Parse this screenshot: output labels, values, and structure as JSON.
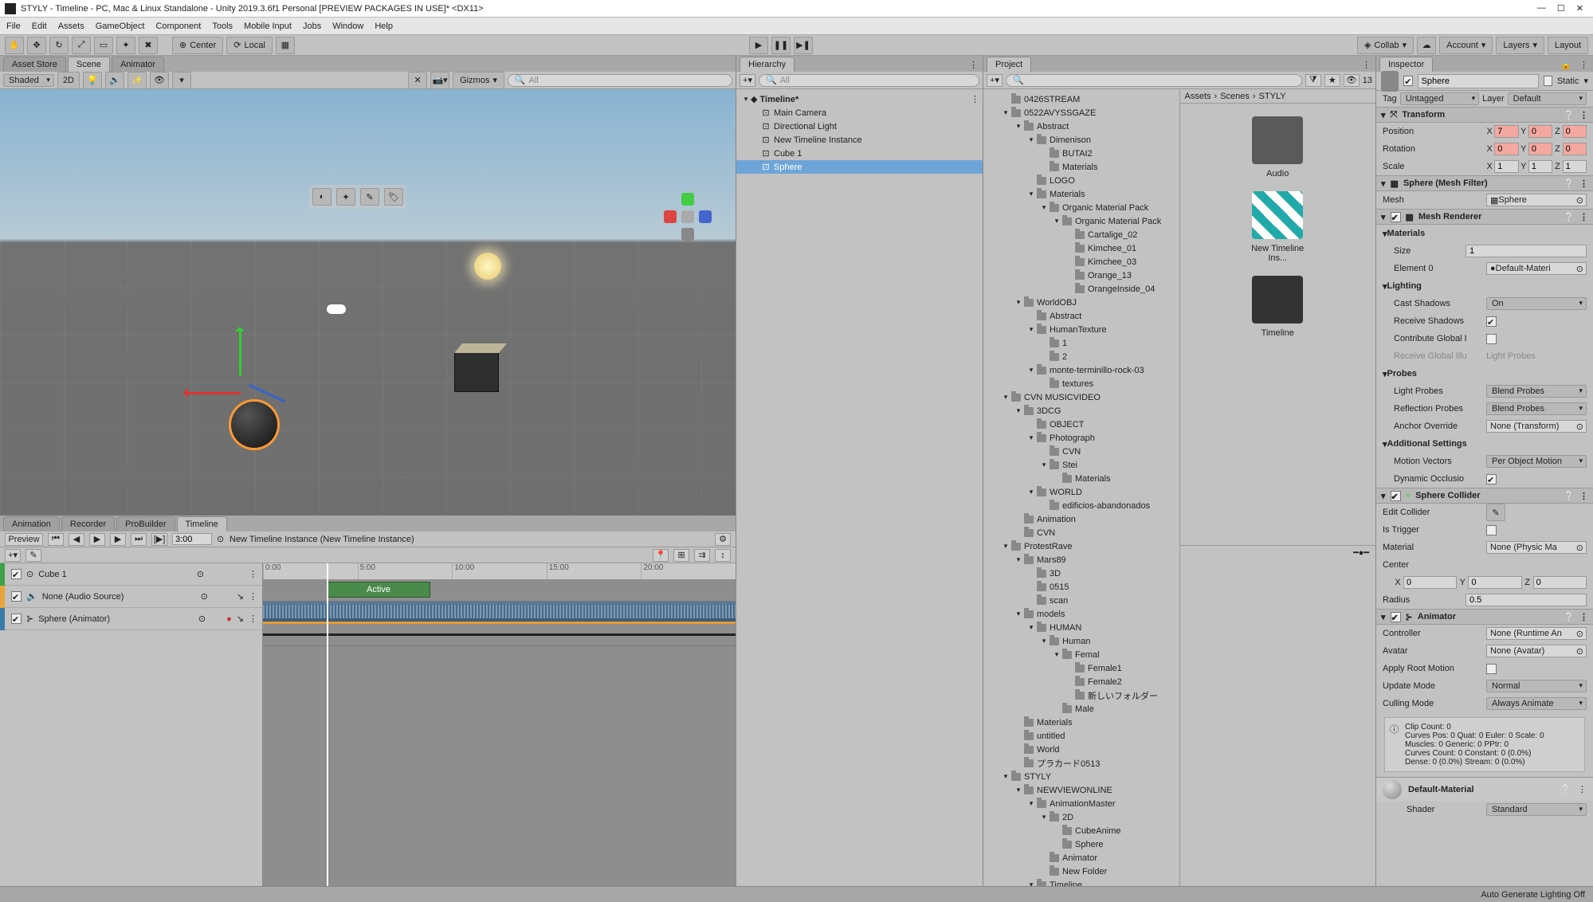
{
  "window": {
    "title": "STYLY - Timeline - PC, Mac & Linux Standalone - Unity 2019.3.6f1 Personal [PREVIEW PACKAGES IN USE]* <DX11>"
  },
  "menu": [
    "File",
    "Edit",
    "Assets",
    "GameObject",
    "Component",
    "Tools",
    "Mobile Input",
    "Jobs",
    "Window",
    "Help"
  ],
  "toolbar": {
    "center": "Center",
    "local": "Local",
    "collab": "Collab",
    "account": "Account",
    "layers": "Layers",
    "layout": "Layout"
  },
  "sceneTabs": {
    "asset": "Asset Store",
    "scene": "Scene",
    "animator": "Animator"
  },
  "sceneBar": {
    "shaded": "Shaded",
    "mode2d": "2D",
    "gizmos": "Gizmos",
    "all": "All"
  },
  "hierarchy": {
    "tab": "Hierarchy",
    "search": "All",
    "rootScene": "Timeline*",
    "items": [
      "Main Camera",
      "Directional Light",
      "New Timeline Instance",
      "Cube 1",
      "Sphere"
    ]
  },
  "project": {
    "tab": "Project",
    "breadcrumb": [
      "Assets",
      "Scenes",
      "STYLY"
    ],
    "favCount": "13",
    "thumbs": [
      {
        "label": "Audio"
      },
      {
        "label": "New Timeline Ins..."
      },
      {
        "label": "Timeline"
      }
    ],
    "tree": [
      {
        "d": 1,
        "label": "0426STREAM"
      },
      {
        "d": 1,
        "label": "0522AVYSSGAZE",
        "open": true
      },
      {
        "d": 2,
        "label": "Abstract",
        "open": true
      },
      {
        "d": 3,
        "label": "Dimenison",
        "open": true
      },
      {
        "d": 4,
        "label": "BUTAI2"
      },
      {
        "d": 4,
        "label": "Materials"
      },
      {
        "d": 3,
        "label": "LOGO"
      },
      {
        "d": 3,
        "label": "Materials",
        "open": true
      },
      {
        "d": 4,
        "label": "Organic Material Pack",
        "open": true
      },
      {
        "d": 5,
        "label": "Organic Material Pack",
        "open": true
      },
      {
        "d": 6,
        "label": "Cartalige_02"
      },
      {
        "d": 6,
        "label": "Kimchee_01"
      },
      {
        "d": 6,
        "label": "Kimchee_03"
      },
      {
        "d": 6,
        "label": "Orange_13"
      },
      {
        "d": 6,
        "label": "OrangeInside_04"
      },
      {
        "d": 2,
        "label": "WorldOBJ",
        "open": true
      },
      {
        "d": 3,
        "label": "Abstract"
      },
      {
        "d": 3,
        "label": "HumanTexture",
        "open": true
      },
      {
        "d": 4,
        "label": "1"
      },
      {
        "d": 4,
        "label": "2"
      },
      {
        "d": 3,
        "label": "monte-terminillo-rock-03",
        "open": true
      },
      {
        "d": 4,
        "label": "textures"
      },
      {
        "d": 1,
        "label": "CVN MUSICVIDEO",
        "open": true
      },
      {
        "d": 2,
        "label": "3DCG",
        "open": true
      },
      {
        "d": 3,
        "label": "OBJECT"
      },
      {
        "d": 3,
        "label": "Photograph",
        "open": true
      },
      {
        "d": 4,
        "label": "CVN"
      },
      {
        "d": 4,
        "label": "Stei",
        "open": true
      },
      {
        "d": 5,
        "label": "Materials"
      },
      {
        "d": 3,
        "label": "WORLD",
        "open": true
      },
      {
        "d": 4,
        "label": "edificios-abandonados"
      },
      {
        "d": 2,
        "label": "Animation"
      },
      {
        "d": 2,
        "label": "CVN"
      },
      {
        "d": 1,
        "label": "ProtestRave",
        "open": true
      },
      {
        "d": 2,
        "label": "Mars89",
        "open": true
      },
      {
        "d": 3,
        "label": "3D"
      },
      {
        "d": 3,
        "label": "0515"
      },
      {
        "d": 3,
        "label": "scan"
      },
      {
        "d": 2,
        "label": "models",
        "open": true
      },
      {
        "d": 3,
        "label": "HUMAN",
        "open": true
      },
      {
        "d": 4,
        "label": "Human",
        "open": true
      },
      {
        "d": 5,
        "label": "Femal",
        "open": true
      },
      {
        "d": 6,
        "label": "Female1"
      },
      {
        "d": 6,
        "label": "Female2"
      },
      {
        "d": 6,
        "label": "新しいフォルダー"
      },
      {
        "d": 5,
        "label": "Male"
      },
      {
        "d": 2,
        "label": "Materials"
      },
      {
        "d": 2,
        "label": "untitled"
      },
      {
        "d": 2,
        "label": "World"
      },
      {
        "d": 2,
        "label": "プラカード0513"
      },
      {
        "d": 1,
        "label": "STYLY",
        "open": true
      },
      {
        "d": 2,
        "label": "NEWVIEWONLINE",
        "open": true
      },
      {
        "d": 3,
        "label": "AnimationMaster",
        "open": true
      },
      {
        "d": 4,
        "label": "2D",
        "open": true
      },
      {
        "d": 5,
        "label": "CubeAnime"
      },
      {
        "d": 5,
        "label": "Sphere"
      },
      {
        "d": 4,
        "label": "Animator"
      },
      {
        "d": 4,
        "label": "New Folder"
      },
      {
        "d": 3,
        "label": "Timeline",
        "open": true
      }
    ]
  },
  "timeline": {
    "tabs": [
      "Animation",
      "Recorder",
      "ProBuilder",
      "Timeline"
    ],
    "preview": "Preview",
    "frame": "3:00",
    "asset": "New Timeline Instance (New Timeline Instance)",
    "ticks": [
      "0:00",
      "5:00",
      "10:00",
      "15:00",
      "20:00"
    ],
    "tracks": [
      {
        "color": "#3aa34a",
        "label": "Cube 1",
        "clip": "Active"
      },
      {
        "color": "#e6a43a",
        "label": "None (Audio Source)"
      },
      {
        "color": "#3a7aa8",
        "label": "Sphere (Animator)"
      }
    ]
  },
  "inspector": {
    "tab": "Inspector",
    "name": "Sphere",
    "static": "Static",
    "tag": "Tag",
    "tagVal": "Untagged",
    "layer": "Layer",
    "layerVal": "Default",
    "transform": {
      "title": "Transform",
      "position": "Position",
      "rotation": "Rotation",
      "scale": "Scale",
      "pos": {
        "x": "7",
        "y": "0",
        "z": "0"
      },
      "rot": {
        "x": "0",
        "y": "0",
        "z": "0"
      },
      "scl": {
        "x": "1",
        "y": "1",
        "z": "1"
      }
    },
    "meshFilter": {
      "title": "Sphere (Mesh Filter)",
      "mesh": "Mesh",
      "meshVal": "Sphere"
    },
    "meshRenderer": {
      "title": "Mesh Renderer",
      "materials": "Materials",
      "size": "Size",
      "sizeVal": "1",
      "el0": "Element 0",
      "el0Val": "Default-Materi",
      "lighting": "Lighting",
      "castShadows": "Cast Shadows",
      "castShadowsVal": "On",
      "receive": "Receive Shadows",
      "contrib": "Contribute Global I",
      "recvGI": "Receive Global Illu",
      "recvGIVal": "Light Probes",
      "probes": "Probes",
      "lightProbes": "Light Probes",
      "lightProbesVal": "Blend Probes",
      "reflProbes": "Reflection Probes",
      "reflProbesVal": "Blend Probes",
      "anchor": "Anchor Override",
      "anchorVal": "None (Transform)",
      "additional": "Additional Settings",
      "motion": "Motion Vectors",
      "motionVal": "Per Object Motion",
      "dynOcc": "Dynamic Occlusio"
    },
    "collider": {
      "title": "Sphere Collider",
      "edit": "Edit Collider",
      "trigger": "Is Trigger",
      "material": "Material",
      "materialVal": "None (Physic Ma",
      "center": "Center",
      "cx": "0",
      "cy": "0",
      "cz": "0",
      "radius": "Radius",
      "radiusVal": "0.5"
    },
    "animator": {
      "title": "Animator",
      "controller": "Controller",
      "controllerVal": "None (Runtime An",
      "avatar": "Avatar",
      "avatarVal": "None (Avatar)",
      "applyRoot": "Apply Root Motion",
      "update": "Update Mode",
      "updateVal": "Normal",
      "culling": "Culling Mode",
      "cullingVal": "Always Animate",
      "info": "Clip Count: 0\nCurves Pos: 0 Quat: 0 Euler: 0 Scale: 0\nMuscles: 0 Generic: 0 PPtr: 0\nCurves Count: 0 Constant: 0 (0.0%)\nDense: 0 (0.0%) Stream: 0 (0.0%)"
    },
    "defaultMat": {
      "title": "Default-Material",
      "shader": "Shader",
      "shaderVal": "Standard"
    }
  },
  "status": "Auto Generate Lighting Off"
}
